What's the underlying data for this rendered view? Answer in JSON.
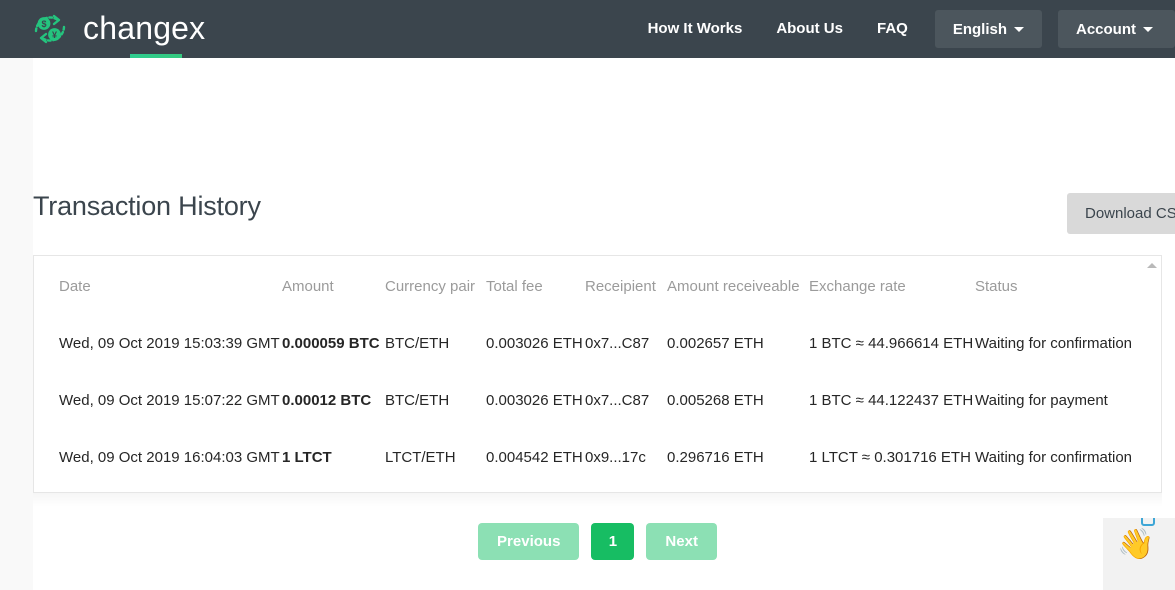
{
  "header": {
    "brand_name": "changex",
    "logo_icon": "currency-exchange-circular-arrows-icon",
    "nav_links": [
      {
        "label": "How It Works",
        "name": "nav-link-how-it-works"
      },
      {
        "label": "About Us",
        "name": "nav-link-about-us"
      },
      {
        "label": "FAQ",
        "name": "nav-link-faq"
      }
    ],
    "language_button": {
      "label": "English",
      "icon": "chevron-down-icon"
    },
    "account_button": {
      "label": "Account",
      "icon": "chevron-down-icon"
    },
    "background_color": "#3b454d",
    "accent_color": "#2ecc8f"
  },
  "main": {
    "page_title": "Transaction History",
    "download_csv_label": "Download CSV",
    "table": {
      "scroll_up_icon": "chevron-up-icon",
      "columns": [
        "Date",
        "Amount",
        "Currency pair",
        "Total fee",
        "Receipient",
        "Amount receiveable",
        "Exchange rate",
        "Status"
      ],
      "rows": [
        {
          "date": "Wed, 09 Oct 2019 15:03:39 GMT",
          "amount": "0.000059 BTC",
          "currency_pair": "BTC/ETH",
          "total_fee": "0.003026 ETH",
          "recipient": "0x7...C87",
          "amount_receivable": "0.002657 ETH",
          "exchange_rate": "1 BTC ≈ 44.966614 ETH",
          "status": "Waiting for confirmation"
        },
        {
          "date": "Wed, 09 Oct 2019 15:07:22 GMT",
          "amount": "0.00012 BTC",
          "currency_pair": "BTC/ETH",
          "total_fee": "0.003026 ETH",
          "recipient": "0x7...C87",
          "amount_receivable": "0.005268 ETH",
          "exchange_rate": "1 BTC ≈ 44.122437 ETH",
          "status": "Waiting for payment"
        },
        {
          "date": "Wed, 09 Oct 2019 16:04:03 GMT",
          "amount": "1 LTCT",
          "currency_pair": "LTCT/ETH",
          "total_fee": "0.004542 ETH",
          "recipient": "0x9...17c",
          "amount_receivable": "0.296716 ETH",
          "exchange_rate": "1 LTCT ≈ 0.301716 ETH",
          "status": "Waiting for confirmation"
        }
      ]
    },
    "pagination": {
      "previous_label": "Previous",
      "current_page": "1",
      "next_label": "Next",
      "active_color": "#17bd63",
      "disabled_color": "#8ce0b4"
    }
  },
  "chat_widget": {
    "hand_icon": "waving-hand-icon",
    "badge_icon": "chat-bubble-icon"
  }
}
